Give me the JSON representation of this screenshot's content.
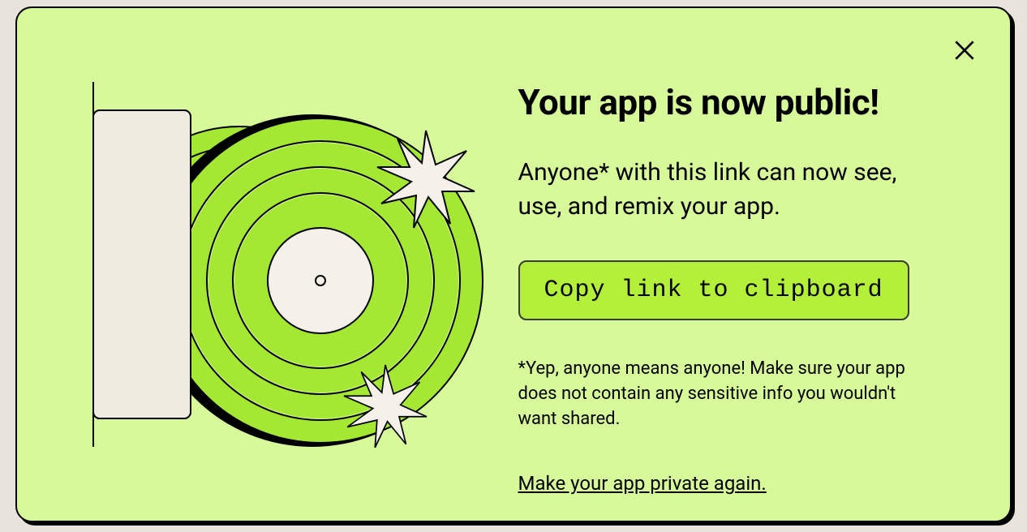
{
  "modal": {
    "title": "Your app is now public!",
    "subtitle": "Anyone* with this link can now see, use, and remix your app.",
    "copy_button_label": "Copy link to clipboard",
    "disclaimer": "*Yep, anyone means anyone! Make sure your app does not contain any sensitive info you wouldn't want shared.",
    "private_link_label": "Make your app private again."
  },
  "colors": {
    "modal_bg": "#d8f999",
    "button_bg": "#b4f03a",
    "record_green": "#a4e834",
    "record_cream": "#f5f1e8"
  }
}
